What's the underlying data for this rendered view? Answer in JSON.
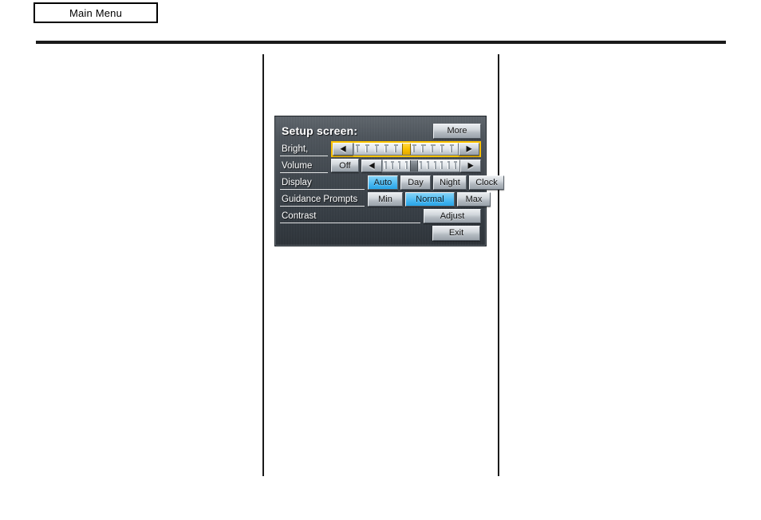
{
  "page": {
    "header_tab_label": "Main Menu"
  },
  "nav_screen": {
    "title": "Setup screen:",
    "more_button": "More",
    "exit_button": "Exit",
    "accent_focus_color": "#ffc400",
    "accent_selected_color": "#3fb2ee",
    "rows": {
      "brightness": {
        "label": "Bright,",
        "left_arrow": "◀",
        "right_arrow": "▶",
        "ticks_total": 11,
        "cursor_index": 5,
        "focused": true
      },
      "volume": {
        "label": "Volume",
        "off_button": "Off",
        "left_arrow": "◀",
        "right_arrow": "▶",
        "ticks_total": 11,
        "cursor_index": 4,
        "focused": false
      },
      "display": {
        "label": "Display",
        "options": [
          {
            "label": "Auto",
            "selected": true
          },
          {
            "label": "Day",
            "selected": false
          },
          {
            "label": "Night",
            "selected": false
          },
          {
            "label": "Clock",
            "selected": false
          }
        ]
      },
      "guidance_prompts": {
        "label": "Guidance Prompts",
        "options": [
          {
            "label": "Min",
            "selected": false
          },
          {
            "label": "Normal",
            "selected": true
          },
          {
            "label": "Max",
            "selected": false
          }
        ]
      },
      "contrast": {
        "label": "Contrast",
        "adjust_button": "Adjust"
      }
    }
  }
}
